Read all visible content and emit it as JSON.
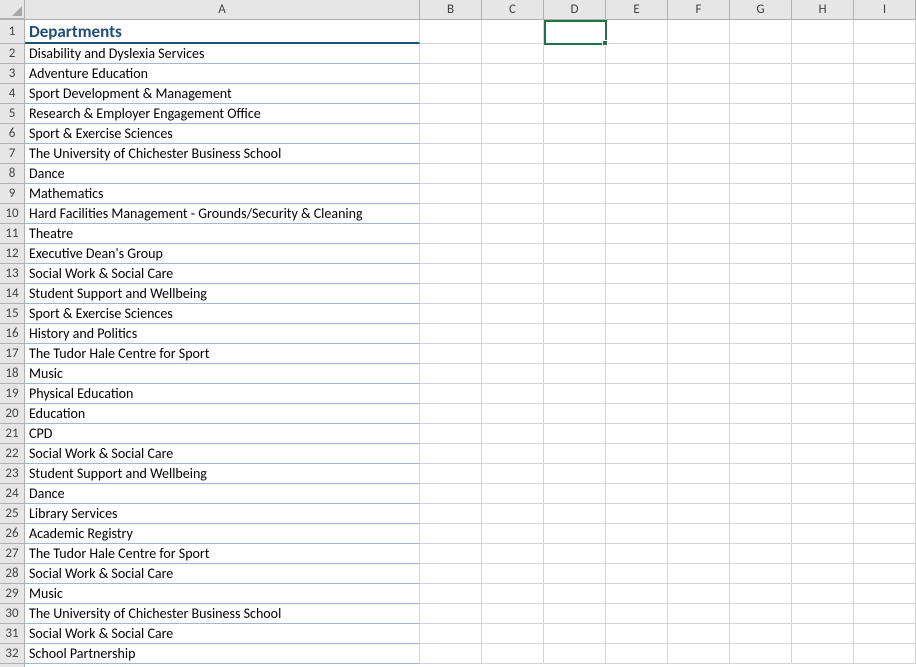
{
  "columns": [
    "A",
    "B",
    "C",
    "D",
    "E",
    "F",
    "G",
    "H",
    "I"
  ],
  "activeCell": "D1",
  "header": {
    "label": "Departments"
  },
  "rows": [
    "Disability and Dyslexia Services",
    "Adventure Education",
    "Sport Development & Management",
    "Research & Employer Engagement Office",
    "Sport & Exercise Sciences",
    "The University of Chichester Business School",
    "Dance",
    "Mathematics",
    "Hard Facilities Management - Grounds/Security & Cleaning",
    "Theatre",
    "Executive Dean's Group",
    "Social Work & Social Care",
    "Student Support and Wellbeing",
    "Sport & Exercise Sciences",
    "History and Politics",
    "The Tudor Hale Centre for Sport",
    "Music",
    "Physical Education",
    "Education",
    "CPD",
    "Social Work & Social Care",
    "Student Support and Wellbeing",
    "Dance",
    "Library Services",
    "Academic Registry",
    "The Tudor Hale Centre for Sport",
    "Social Work & Social Care",
    "Music",
    "The University of Chichester Business School",
    "Social Work & Social Care",
    "School Partnership"
  ]
}
